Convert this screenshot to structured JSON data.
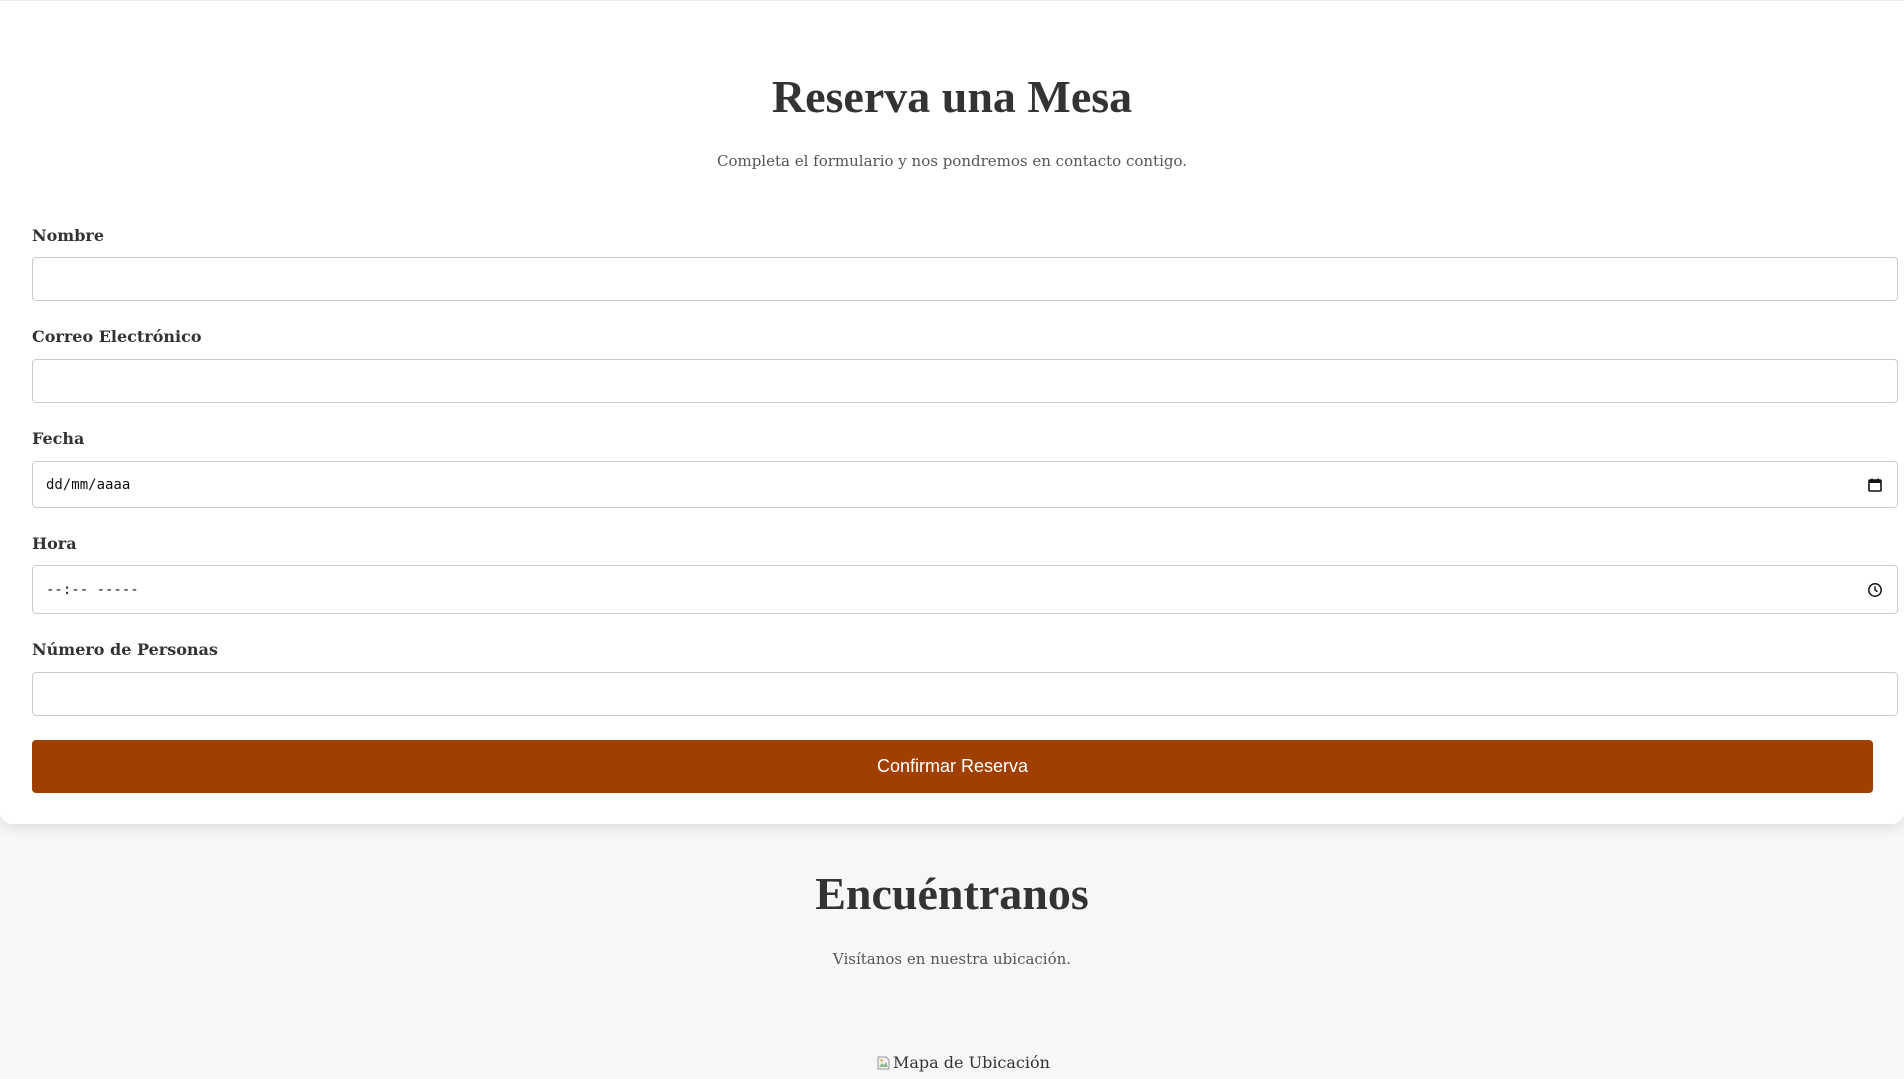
{
  "reservation": {
    "title": "Reserva una Mesa",
    "subtitle": "Completa el formulario y nos pondremos en contacto contigo.",
    "fields": {
      "name": {
        "label": "Nombre",
        "value": ""
      },
      "email": {
        "label": "Correo Electrónico",
        "value": ""
      },
      "date": {
        "label": "Fecha",
        "placeholder": "dd/mm/aaaa",
        "icon": "calendar-icon"
      },
      "time": {
        "label": "Hora",
        "placeholder": "--:-- -----",
        "icon": "clock-icon"
      },
      "guests": {
        "label": "Número de Personas",
        "value": ""
      }
    },
    "submit_label": "Confirmar Reserva"
  },
  "location": {
    "title": "Encuéntranos",
    "subtitle": "Visítanos en nuestra ubicación.",
    "map_alt": "Mapa de Ubicación"
  },
  "colors": {
    "accent": "#a04000",
    "page_bg": "#f7f7f7",
    "card_bg": "#ffffff",
    "text": "#333333"
  }
}
